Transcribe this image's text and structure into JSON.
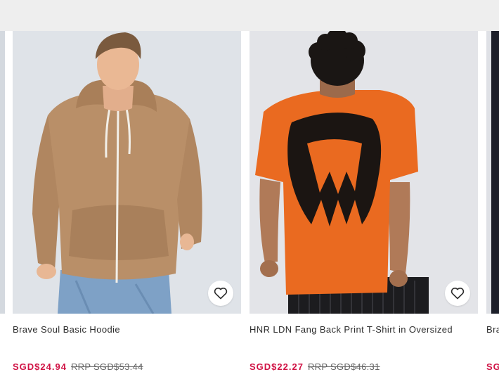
{
  "products": [
    {
      "name": "Brave Soul Basic Hoodie",
      "price": "SGD$24.94",
      "rrp": "RRP SGD$53.44",
      "wishlist_icon": "heart-icon"
    },
    {
      "name": "HNR LDN Fang Back Print T-Shirt in Oversized",
      "price": "SGD$22.27",
      "rrp": "RRP SGD$46.31",
      "wishlist_icon": "heart-icon"
    },
    {
      "name": "Bra",
      "price": "SG"
    }
  ],
  "colors": {
    "price": "#d01345",
    "text": "#2d2d2d",
    "rrp": "#666666",
    "top_band": "#eeeeee"
  }
}
